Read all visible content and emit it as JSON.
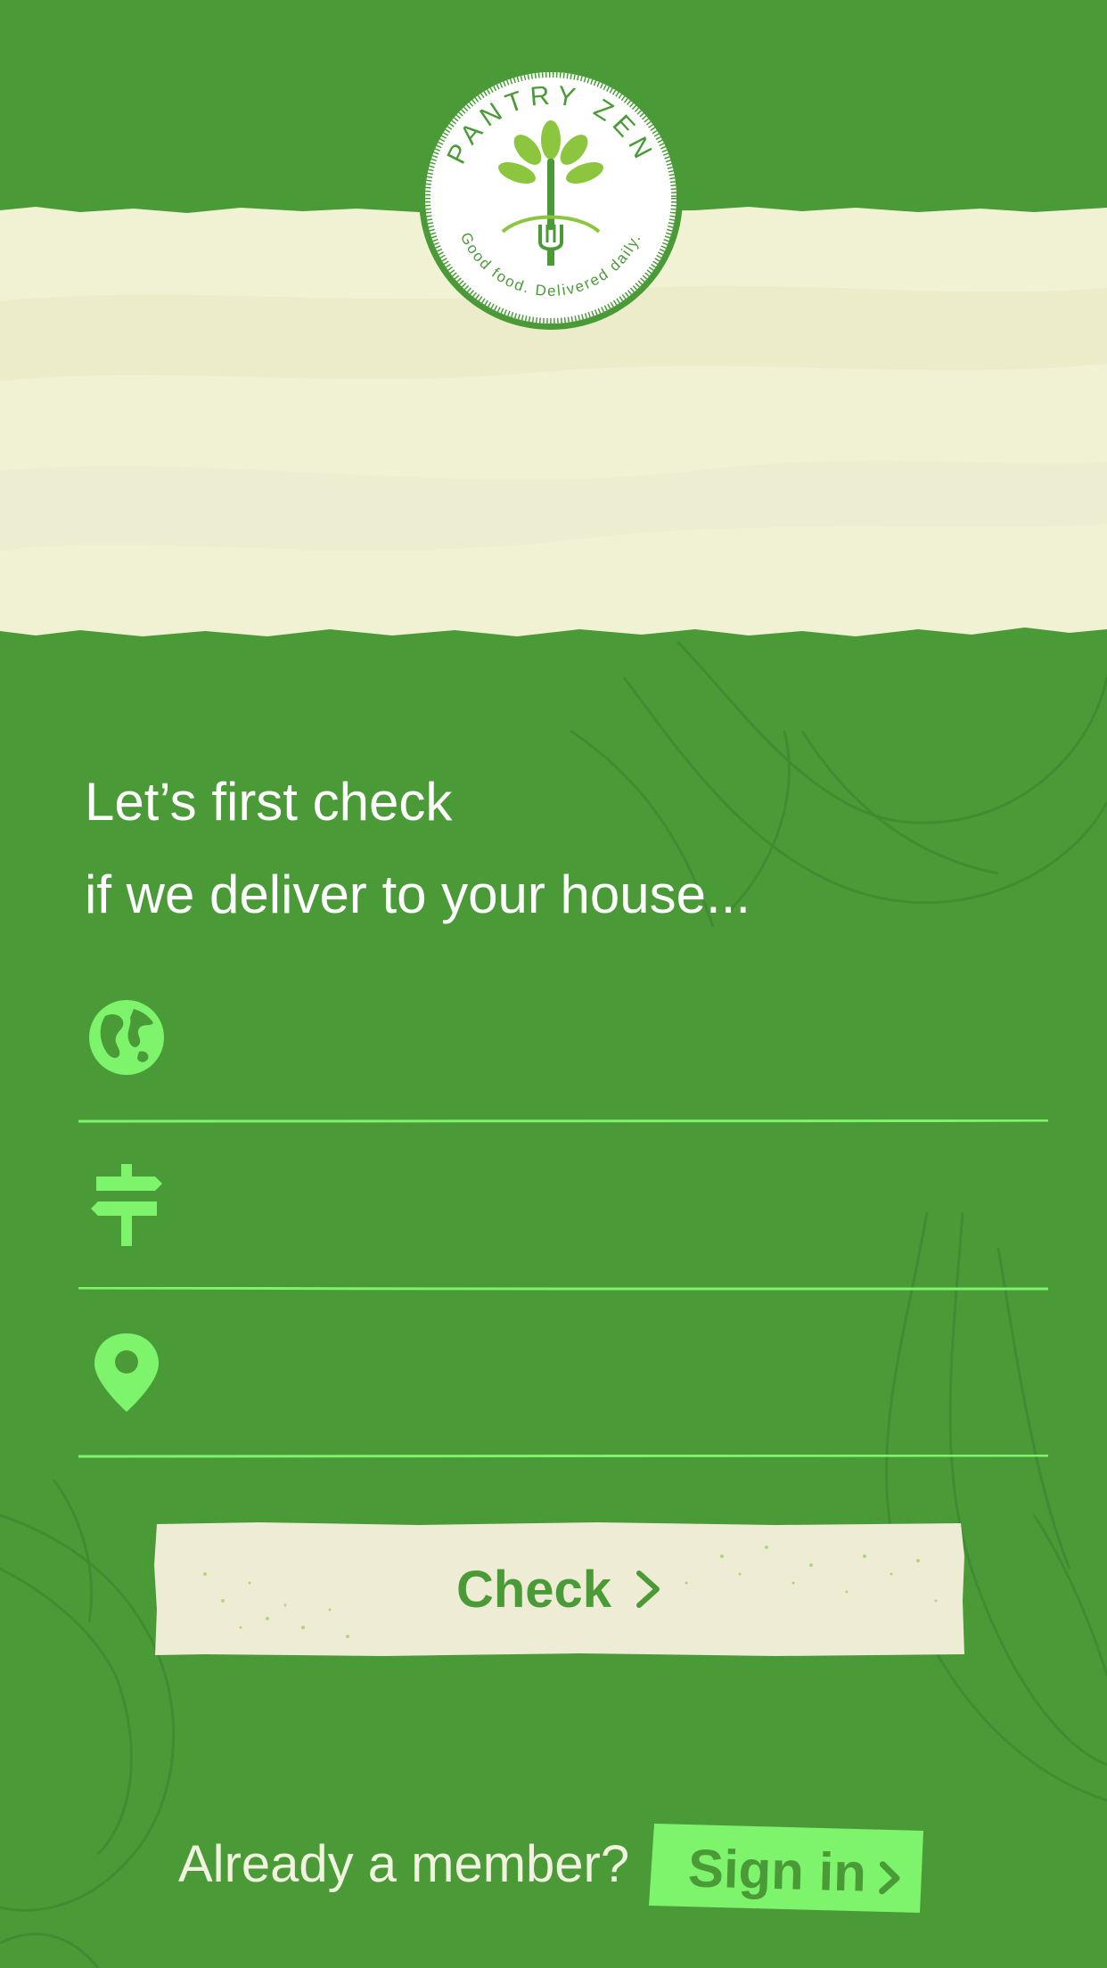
{
  "app": {
    "brand_name": "PANTRY ZEN",
    "tagline": "Good food. Delivered daily."
  },
  "colors": {
    "background": "#4a9b37",
    "banner": "#f1f1d4",
    "accent": "#7ef36c",
    "button_bg": "#eeecd5",
    "text": "#ffffff"
  },
  "intro": {
    "line1": "Let’s first check",
    "line2": "if we deliver to your house..."
  },
  "form": {
    "fields": [
      {
        "icon": "globe-icon",
        "value": "",
        "placeholder": ""
      },
      {
        "icon": "signpost-icon",
        "value": "",
        "placeholder": ""
      },
      {
        "icon": "location-pin-icon",
        "value": "",
        "placeholder": ""
      }
    ],
    "check_label": "Check"
  },
  "footer": {
    "already_member": "Already a member?",
    "signin_label": "Sign in"
  }
}
